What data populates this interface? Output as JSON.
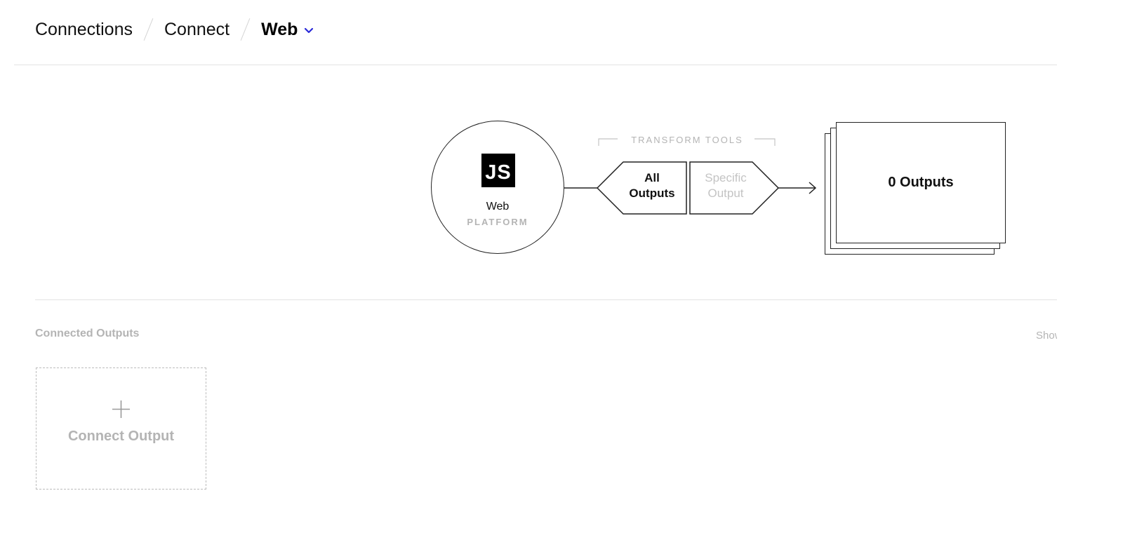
{
  "breadcrumb": {
    "items": [
      "Connections",
      "Connect"
    ],
    "current": "Web"
  },
  "diagram": {
    "source": {
      "logo_text": "JS",
      "name": "Web",
      "type": "PLATFORM"
    },
    "transform": {
      "label": "TRANSFORM TOOLS",
      "all": {
        "line1": "All",
        "line2": "Outputs",
        "active": true
      },
      "specific": {
        "line1": "Specific",
        "line2": "Output",
        "active": false
      }
    },
    "outputs": {
      "label": "0 Outputs"
    }
  },
  "connected_outputs": {
    "title": "Connected Outputs",
    "show_link": "Show",
    "add_label": "Connect Output"
  },
  "colors": {
    "accent": "#2a2ad8",
    "muted": "#b4b4b4",
    "line": "#222222",
    "divider": "#e3e3e3"
  },
  "icons": {
    "dropdown": "chevron-down-icon",
    "add": "plus-icon",
    "arrow": "arrow-right-icon"
  }
}
